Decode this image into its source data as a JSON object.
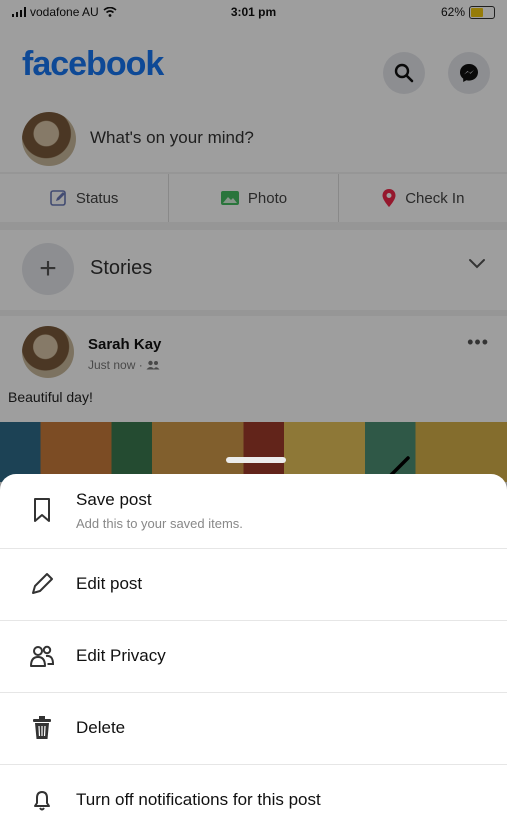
{
  "status_bar": {
    "carrier": "vodafone AU",
    "time": "3:01 pm",
    "battery": "62%",
    "battery_level": 0.62
  },
  "header": {
    "logo": "facebook",
    "buttons": [
      "search-icon",
      "messenger-icon"
    ]
  },
  "composer": {
    "placeholder": "What's on your mind?"
  },
  "post_actions": [
    {
      "label": "Status",
      "icon": "status-icon",
      "color": "#6b7ab8"
    },
    {
      "label": "Photo",
      "icon": "photo-icon",
      "color": "#45bd62"
    },
    {
      "label": "Check In",
      "icon": "checkin-icon",
      "color": "#f02849"
    }
  ],
  "stories": {
    "label": "Stories"
  },
  "post": {
    "author": "Sarah Kay",
    "meta": "Just now · ",
    "text": "Beautiful day!"
  },
  "sheet": {
    "items": [
      {
        "title": "Save post",
        "subtitle": "Add this to your saved items.",
        "icon": "bookmark-icon"
      },
      {
        "title": "Edit post",
        "icon": "pencil-icon"
      },
      {
        "title": "Edit Privacy",
        "icon": "people-icon"
      },
      {
        "title": "Delete",
        "icon": "trash-icon"
      },
      {
        "title": "Turn off notifications for this post",
        "icon": "bell-icon"
      }
    ]
  },
  "colors": {
    "brand": "#1877f2",
    "overlay": "rgba(0,0,0,0.38)"
  }
}
